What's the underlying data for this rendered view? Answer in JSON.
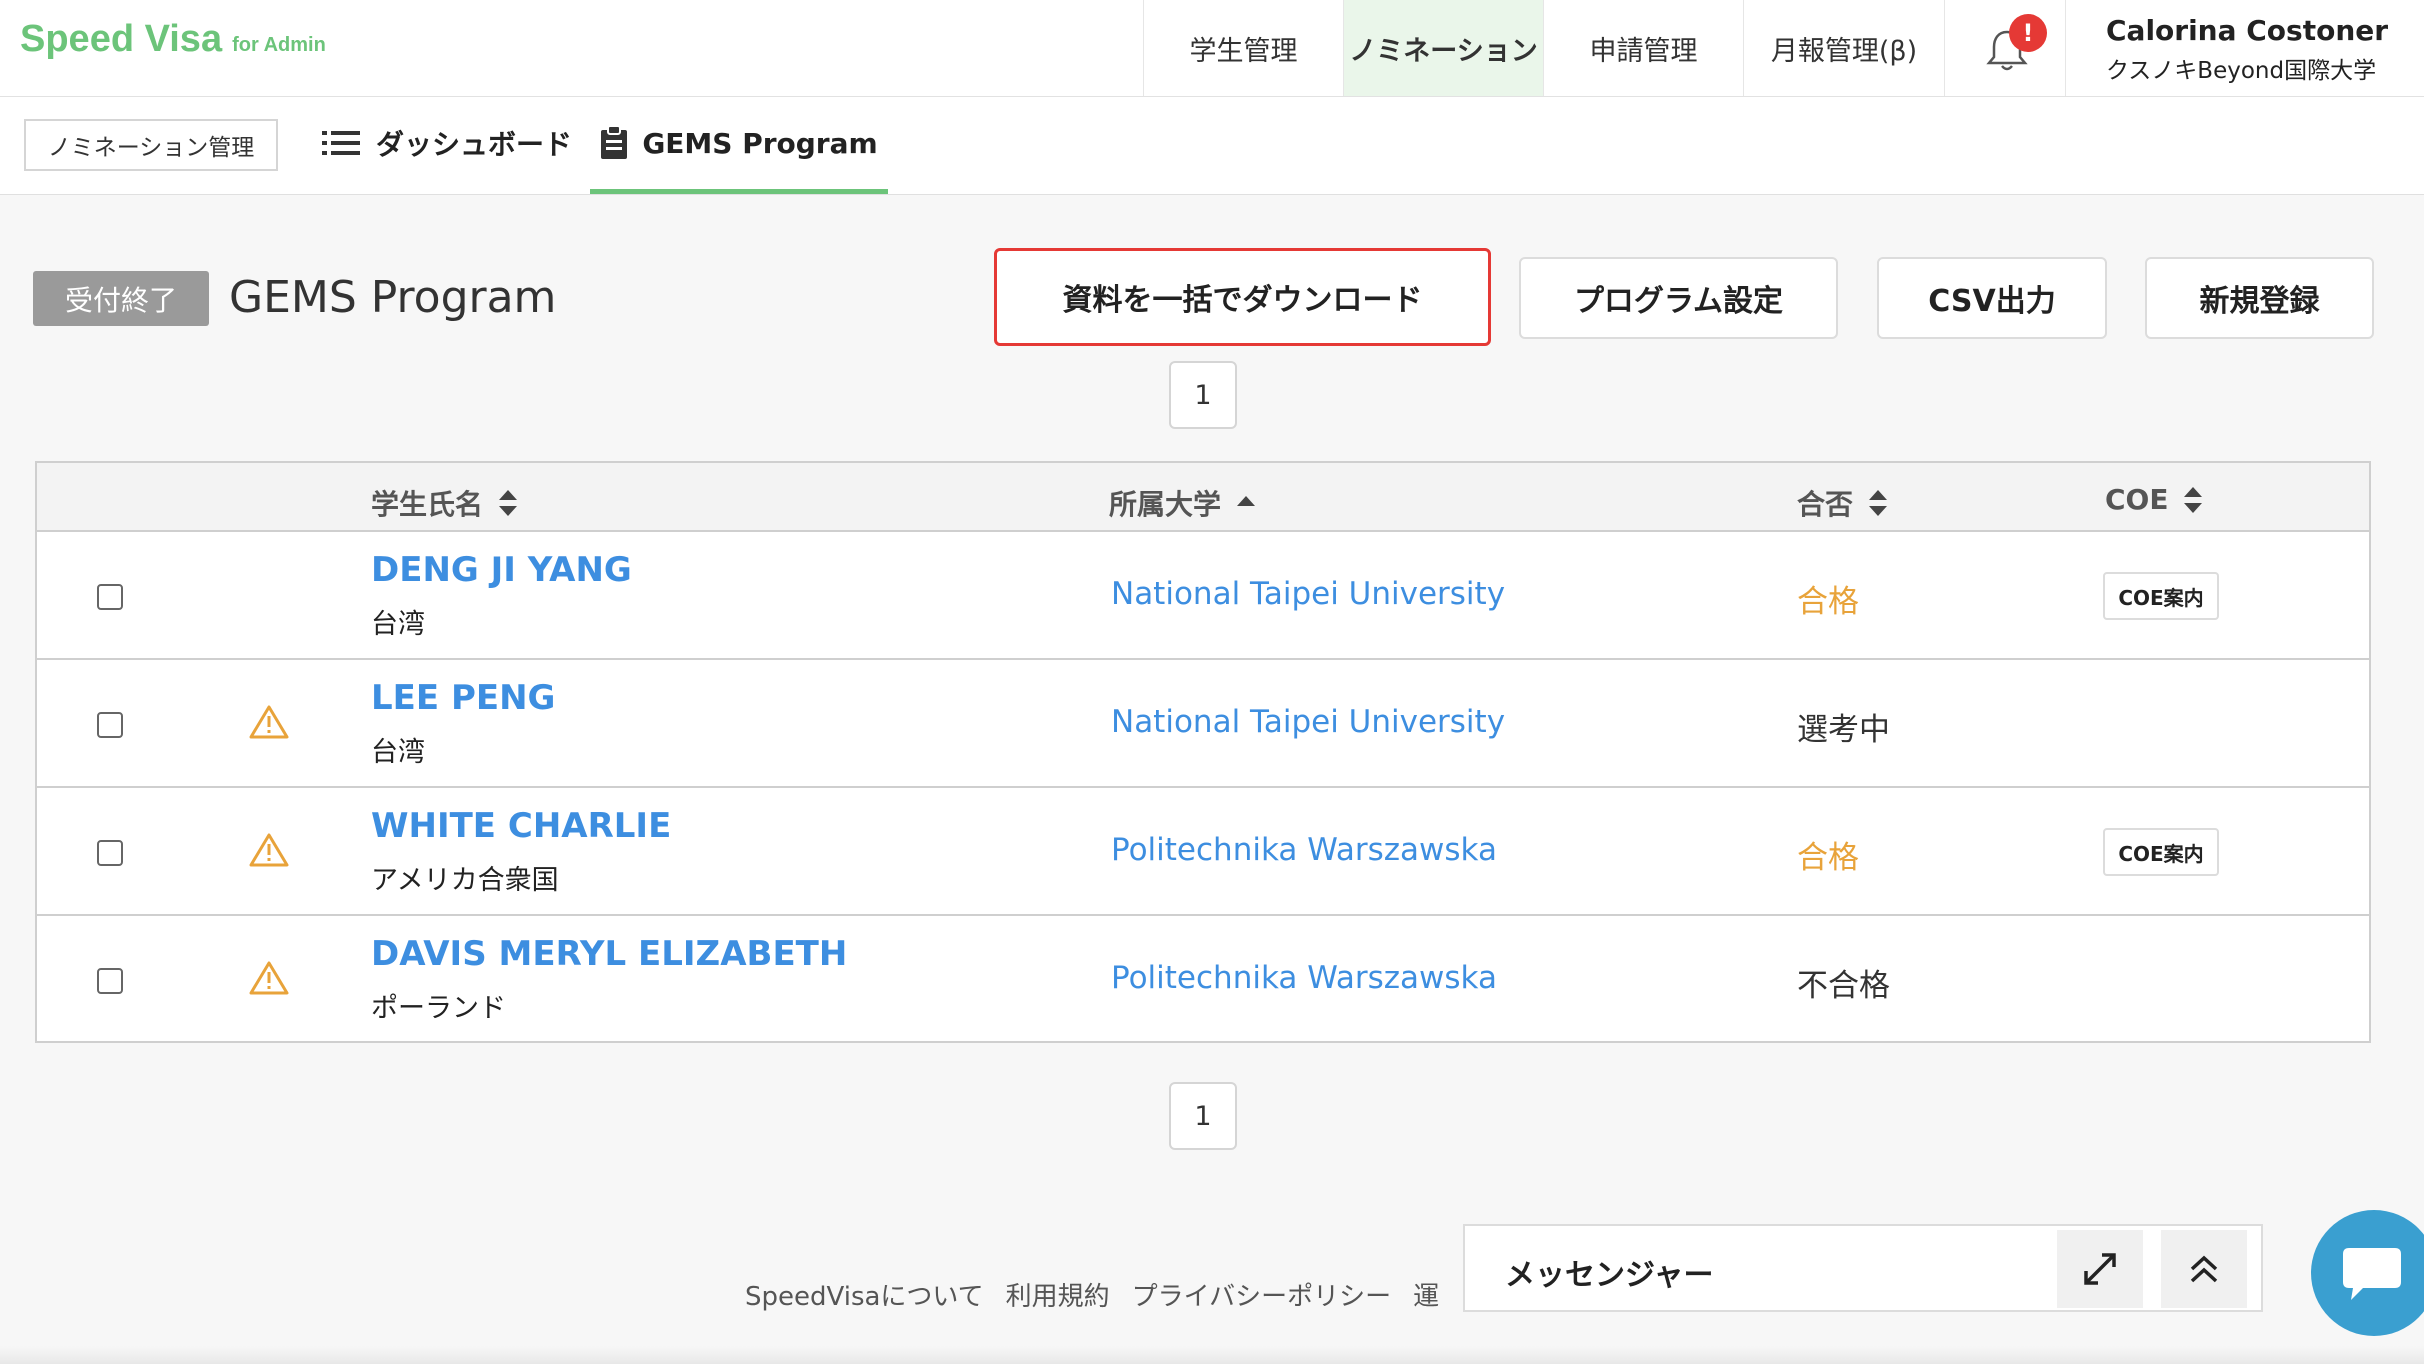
{
  "header": {
    "logo_main": "Speed Visa",
    "logo_sub": "for Admin",
    "nav": [
      {
        "label": "学生管理",
        "active": false
      },
      {
        "label": "ノミネーション",
        "active": true
      },
      {
        "label": "申請管理",
        "active": false
      },
      {
        "label": "月報管理(β)",
        "active": false
      }
    ],
    "notification_badge": "!",
    "user_name": "Calorina Costoner",
    "user_org": "クスノキBeyond国際大学"
  },
  "subnav": {
    "nomination_mgmt": "ノミネーション管理",
    "dashboard": "ダッシュボード",
    "program": "GEMS Program"
  },
  "page": {
    "status": "受付終了",
    "title": "GEMS Program",
    "buttons": {
      "bulk_download": "資料を一括でダウンロード",
      "program_settings": "プログラム設定",
      "csv_export": "CSV出力",
      "new_register": "新規登録"
    },
    "page_number": "1"
  },
  "table": {
    "headers": {
      "name": "学生氏名",
      "university": "所属大学",
      "result": "合否",
      "coe": "COE"
    },
    "rows": [
      {
        "name": "DENG JI YANG",
        "country": "台湾",
        "university": "National Taipei University",
        "result": "合格",
        "warning": false,
        "coe": "COE案内"
      },
      {
        "name": "LEE PENG",
        "country": "台湾",
        "university": "National Taipei University",
        "result": "選考中",
        "warning": true,
        "coe": ""
      },
      {
        "name": "WHITE CHARLIE",
        "country": "アメリカ合衆国",
        "university": "Politechnika Warszawska",
        "result": "合格",
        "warning": true,
        "coe": "COE案内"
      },
      {
        "name": "DAVIS MERYL ELIZABETH",
        "country": "ポーランド",
        "university": "Politechnika Warszawska",
        "result": "不合格",
        "warning": true,
        "coe": ""
      }
    ]
  },
  "footer": {
    "links": [
      "SpeedVisaについて",
      "利用規約",
      "プライバシーポリシー",
      "運"
    ]
  },
  "messenger": {
    "title": "メッセンジャー"
  },
  "colors": {
    "brand": "#6cc47a",
    "link": "#3d8ee0",
    "pass": "#e8a33a",
    "alert": "#e53935",
    "chat": "#3a9fd0"
  }
}
